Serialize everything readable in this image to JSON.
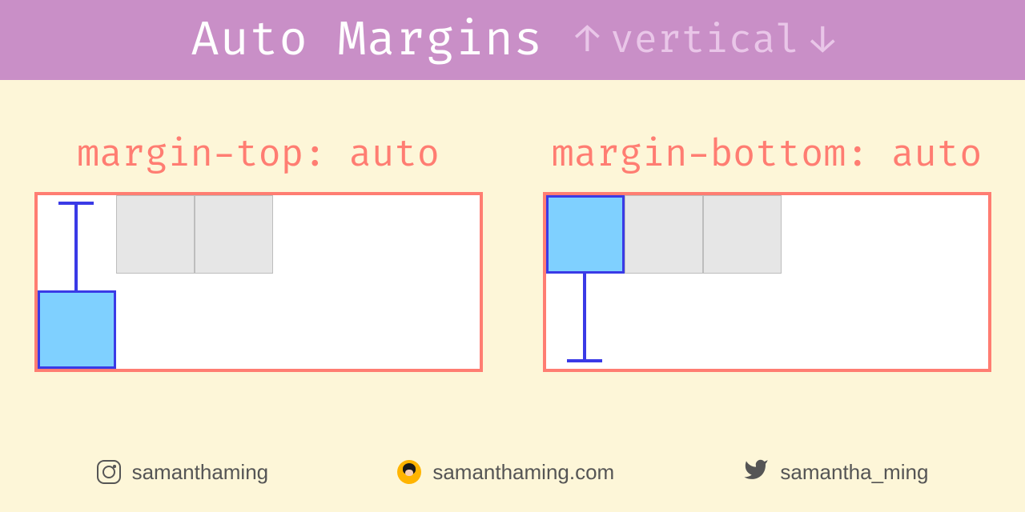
{
  "header": {
    "title": "Auto Margins",
    "subtitle_label": "vertical",
    "arrow_up": "↑",
    "arrow_down": "↓"
  },
  "panels": {
    "left": {
      "title": "margin-top: auto"
    },
    "right": {
      "title": "margin-bottom: auto"
    }
  },
  "footer": {
    "instagram": "samanthaming",
    "website": "samanthaming.com",
    "twitter": "samantha_ming"
  },
  "colors": {
    "header_bg": "#c98fc7",
    "body_bg": "#fdf6d8",
    "accent": "#ff7d72",
    "blue": "#3a3ae6",
    "blue_fill": "#7fd0ff",
    "grey": "#e6e6e6"
  }
}
